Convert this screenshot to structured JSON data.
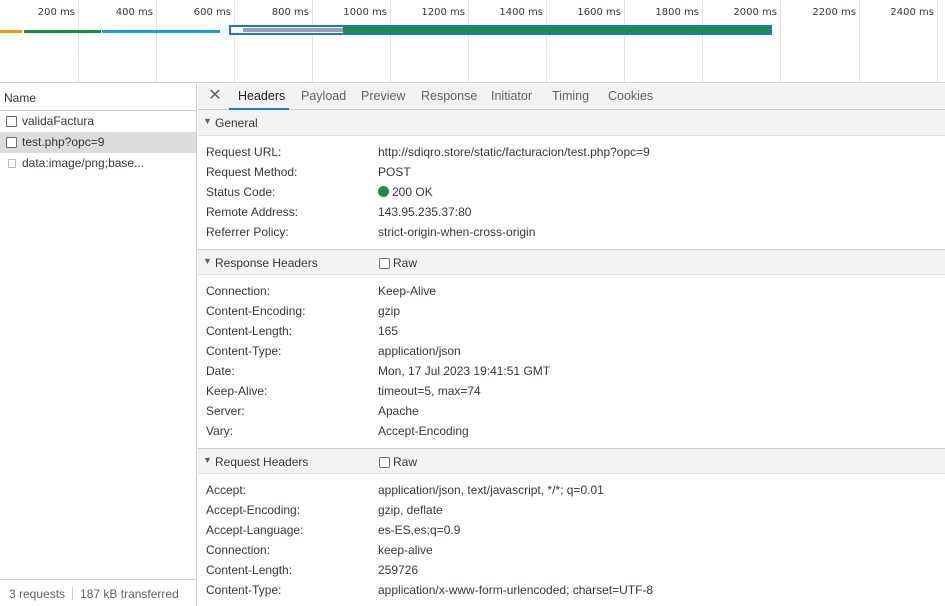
{
  "overview": {
    "ticks": [
      "200 ms",
      "400 ms",
      "600 ms",
      "800 ms",
      "1000 ms",
      "1200 ms",
      "1400 ms",
      "1600 ms",
      "1800 ms",
      "2000 ms",
      "2200 ms",
      "2400 ms"
    ]
  },
  "request_list": {
    "column_header": "Name",
    "items": [
      {
        "name": "validaFactura",
        "icon": "document-icon",
        "selected": false
      },
      {
        "name": "test.php?opc=9",
        "icon": "document-icon",
        "selected": true
      },
      {
        "name": "data:image/png;base...",
        "icon": "image-icon",
        "selected": false
      }
    ],
    "status": {
      "requests": "3 requests",
      "transferred": "187 kB transferred"
    }
  },
  "tabs": {
    "close_icon": "close-icon",
    "items": [
      "Headers",
      "Payload",
      "Preview",
      "Response",
      "Initiator",
      "Timing",
      "Cookies"
    ],
    "active": "Headers"
  },
  "general": {
    "title": "General",
    "rows": [
      {
        "key": "Request URL:",
        "value": "http://sdiqro.store/static/facturacion/test.php?opc=9"
      },
      {
        "key": "Request Method:",
        "value": "POST"
      },
      {
        "key": "Status Code:",
        "value": "200 OK"
      },
      {
        "key": "Remote Address:",
        "value": "143.95.235.37:80"
      },
      {
        "key": "Referrer Policy:",
        "value": "strict-origin-when-cross-origin"
      }
    ],
    "status_color": "#1e8e3e"
  },
  "response_headers": {
    "title": "Response Headers",
    "raw_label": "Raw",
    "rows": [
      {
        "key": "Connection:",
        "value": "Keep-Alive"
      },
      {
        "key": "Content-Encoding:",
        "value": "gzip"
      },
      {
        "key": "Content-Length:",
        "value": "165"
      },
      {
        "key": "Content-Type:",
        "value": "application/json"
      },
      {
        "key": "Date:",
        "value": "Mon, 17 Jul 2023 19:41:51 GMT"
      },
      {
        "key": "Keep-Alive:",
        "value": "timeout=5, max=74"
      },
      {
        "key": "Server:",
        "value": "Apache"
      },
      {
        "key": "Vary:",
        "value": "Accept-Encoding"
      }
    ]
  },
  "request_headers": {
    "title": "Request Headers",
    "raw_label": "Raw",
    "rows": [
      {
        "key": "Accept:",
        "value": "application/json, text/javascript, */*; q=0.01"
      },
      {
        "key": "Accept-Encoding:",
        "value": "gzip, deflate"
      },
      {
        "key": "Accept-Language:",
        "value": "es-ES,es;q=0.9"
      },
      {
        "key": "Connection:",
        "value": "keep-alive"
      },
      {
        "key": "Content-Length:",
        "value": "259726"
      },
      {
        "key": "Content-Type:",
        "value": "application/x-www-form-urlencoded; charset=UTF-8"
      }
    ]
  },
  "colors": {
    "accent": "#1a73e8",
    "receiving": "#1e8e3e",
    "queued": "#9aa0a6",
    "bar_orange": "#f29900",
    "bar_green": "#1e8e3e",
    "bar_blue": "#1a9be6"
  }
}
